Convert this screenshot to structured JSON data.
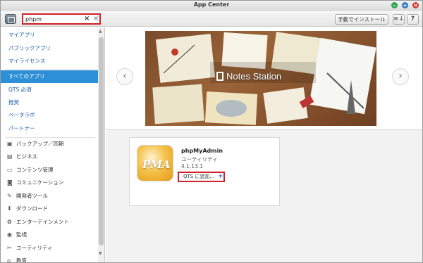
{
  "window": {
    "title": "App Center"
  },
  "toolbar": {
    "search_value": "phpm",
    "clear_label": "×",
    "close_label": "×",
    "install_label": "手動でインストール",
    "sort_label": "≡↓",
    "help_label": "?"
  },
  "sidebar": {
    "top_items": [
      {
        "label": "マイアプリ"
      },
      {
        "label": "パブリックアプリ"
      },
      {
        "label": "マイライセンス"
      }
    ],
    "main_items": [
      {
        "label": "すべてのアプリ"
      },
      {
        "label": "QTS 必須"
      },
      {
        "label": "推奨"
      },
      {
        "label": "ベータラボ"
      },
      {
        "label": "パートナー"
      }
    ],
    "categories": [
      {
        "label": "バックアップ／同期",
        "icon": "backup-icon"
      },
      {
        "label": "ビジネス",
        "icon": "briefcase-icon"
      },
      {
        "label": "コンテンツ管理",
        "icon": "content-icon"
      },
      {
        "label": "コミュニケーション",
        "icon": "chat-icon"
      },
      {
        "label": "開発者ツール",
        "icon": "wrench-icon"
      },
      {
        "label": "ダウンロード",
        "icon": "download-icon"
      },
      {
        "label": "エンターテインメント",
        "icon": "entertainment-icon"
      },
      {
        "label": "監視",
        "icon": "monitor-icon"
      },
      {
        "label": "ユーティリティ",
        "icon": "utility-icon"
      },
      {
        "label": "教育",
        "icon": "education-icon"
      }
    ]
  },
  "banner": {
    "label": "Notes Station"
  },
  "result": {
    "icon_text": "PMA",
    "name": "phpMyAdmin",
    "category": "ユーティリティ",
    "version": "4.1.13.1",
    "add_label": "QTS に追加...",
    "add_plus": "+"
  },
  "colors": {
    "accent": "#2d8fd5",
    "highlight": "#d0202a"
  }
}
